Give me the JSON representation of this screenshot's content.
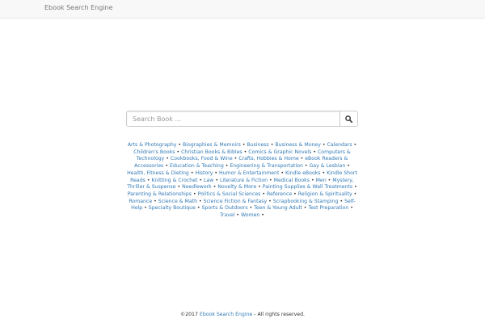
{
  "navbar": {
    "brand": "Ebook Search Engine"
  },
  "search": {
    "placeholder": "Search Book ...",
    "button_icon": "search-icon"
  },
  "categories": [
    "Arts & Photography",
    "Biographies & Memoirs",
    "Business",
    "Business & Money",
    "Calendars",
    "Children's Books",
    "Christian Books & Bibles",
    "Comics & Graphic Novels",
    "Computers & Technology",
    "Cookbooks, Food & Wine",
    "Crafts, Hobbies & Home",
    "eBook Readers & Accessories",
    "Education & Teaching",
    "Engineering & Transportation",
    "Gay & Lesbian",
    "Health, Fitness & Dieting",
    "History",
    "Humor & Entertainment",
    "Kindle eBooks",
    "Kindle Short Reads",
    "Knitting & Crochet",
    "Law",
    "Literature & Fiction",
    "Medical Books",
    "Men",
    "Mystery, Thriller & Suspense",
    "Needlework",
    "Novelty & More",
    "Painting Supplies & Wall Treatments",
    "Parenting & Relationships",
    "Politics & Social Sciences",
    "Reference",
    "Religion & Spirituality",
    "Romance",
    "Science & Math",
    "Science Fiction & Fantasy",
    "Scrapbooking & Stamping",
    "Self-Help",
    "Specialty Boutique",
    "Sports & Outdoors",
    "Teen & Young Adult",
    "Test Preparation",
    "Travel",
    "Women"
  ],
  "separator": "•",
  "footer": {
    "prefix": "©2017",
    "link": "Ebook Search Engine",
    "suffix": "- All rights reserved."
  },
  "colors": {
    "link": "#337ab7",
    "navbar_bg": "#f8f8f8",
    "brand_text": "#777777"
  }
}
